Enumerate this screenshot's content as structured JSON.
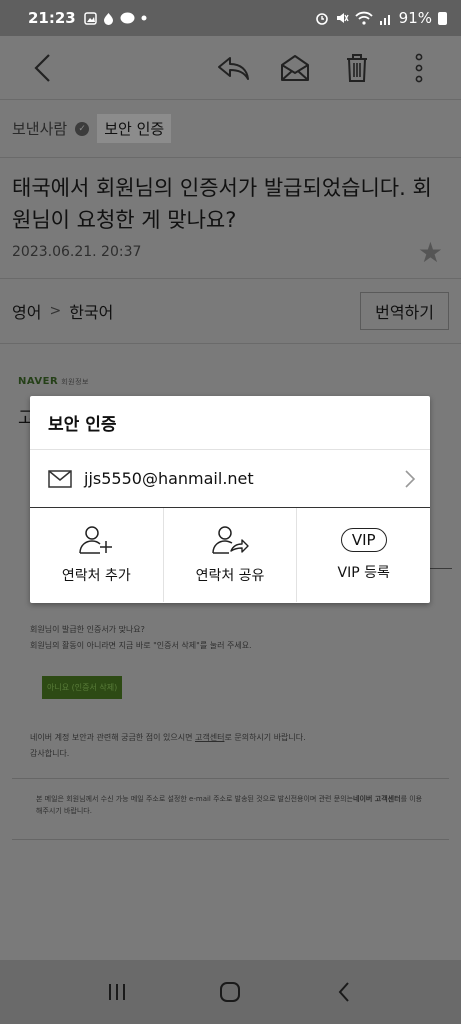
{
  "status": {
    "time": "21:23",
    "battery": "91%"
  },
  "toolbar": {
    "icons": [
      "back-icon",
      "reply-icon",
      "mail-open-icon",
      "trash-icon",
      "more-icon"
    ]
  },
  "sender": {
    "label": "보낸사람",
    "verify_chip": "보안 인증"
  },
  "mail": {
    "subject": "태국에서 회원님의 인증서가 발급되었습니다. 회원님이 요청한 게 맞나요?",
    "date": "2023.06.21. 20:37"
  },
  "translate": {
    "from": "영어",
    "to": "한국어",
    "button": "번역하기"
  },
  "body": {
    "logo": "NAVER",
    "logo_sub": "회원정보",
    "heading": "고",
    "line1": "회원님이 발급한 인증서가 맞나요?",
    "line2": "회원님의 활동이 아니라면 지금 바로 \"인증서 삭제\"를 눌러 주세요.",
    "green_button": "아니요 (인증서 삭제)",
    "line3_pre": "네이버 계정 보안과 관련해 궁금한 점이 있으시면 ",
    "line3_link": "고객센터",
    "line3_post": "로 문의하시기 바랍니다.",
    "line4": "감사합니다.",
    "footer_pre": "본 메일은 회원님께서 수신 가능 메일 주소로 설정한 e-mail 주소로 발송된 것으로 발신전용이며 관련 문의는",
    "footer_strong": "네이버 고객센터",
    "footer_post": "를 이용해주시기 바랍니다."
  },
  "dialog": {
    "title": "보안 인증",
    "email": "jjs5550@hanmail.net",
    "actions": [
      {
        "label": "연락처 추가",
        "icon": "person-add-icon"
      },
      {
        "label": "연락처 공유",
        "icon": "person-share-icon"
      },
      {
        "label": "VIP 등록",
        "icon": "vip-icon",
        "badge": "VIP"
      }
    ]
  },
  "navbar": {
    "icons": [
      "recent-apps-icon",
      "home-icon",
      "back-nav-icon"
    ]
  }
}
